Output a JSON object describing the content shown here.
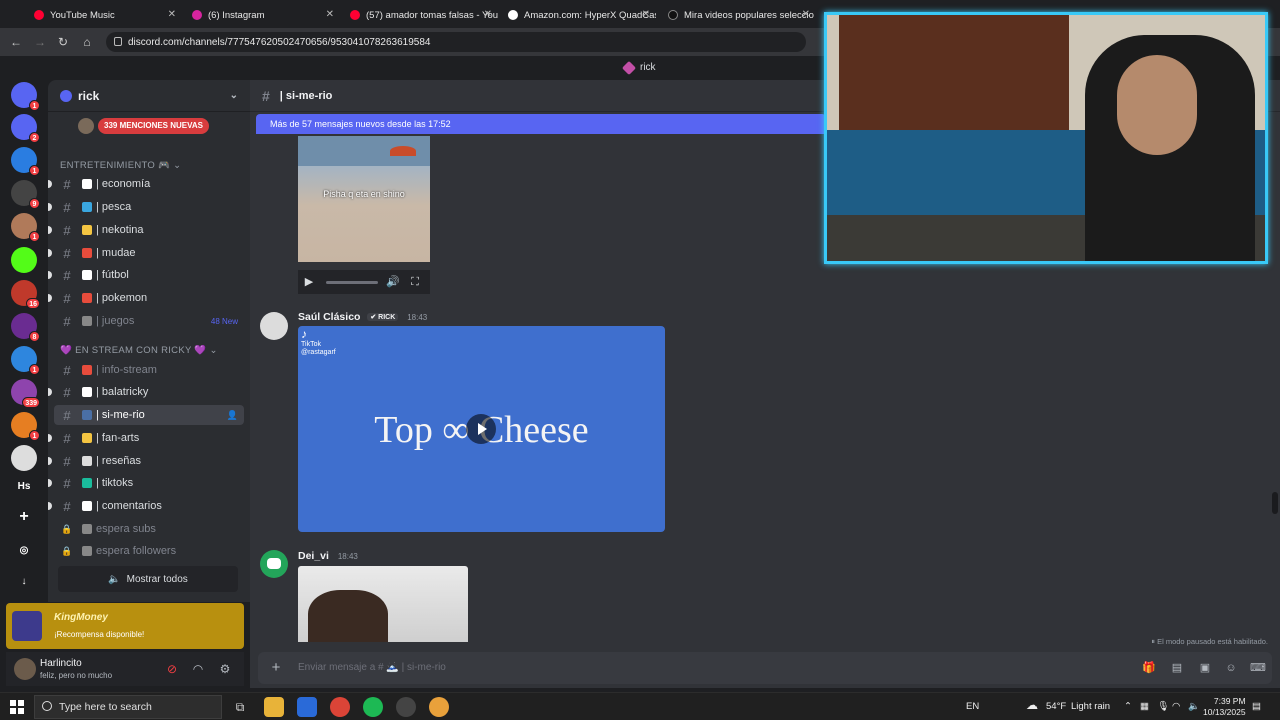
{
  "browser": {
    "tabs": [
      {
        "title": "YouTube Music",
        "color": "#ff0033"
      },
      {
        "title": "(6) Instagram",
        "color": "#d6249f"
      },
      {
        "title": "(57) amador tomas falsas - You",
        "color": "#ff0033"
      },
      {
        "title": "Amazon.com: HyperX QuadCas",
        "color": "#ffffff"
      },
      {
        "title": "Mira videos populares seleccio",
        "color": "#111111"
      }
    ],
    "url": "discord.com/channels/777547620502470656/953041078263619584"
  },
  "title_bar": {
    "server": "rick"
  },
  "guild_rail": {
    "items": [
      {
        "icon": "discord-home-icon",
        "badge": "1",
        "color": "#5865f2"
      },
      {
        "icon": "discord-server-icon",
        "badge": "2",
        "color": "#5865f2"
      },
      {
        "icon": "cube-server-icon",
        "badge": "1",
        "color": "#2a7de1"
      },
      {
        "icon": "mvp-server-icon",
        "badge": "9",
        "color": "#444444"
      },
      {
        "icon": "avatar-server-icon",
        "badge": "1",
        "color": "#b07a5a"
      },
      {
        "icon": "kick-server-icon",
        "badge": "",
        "color": "#53fc18"
      },
      {
        "icon": "red-server-icon",
        "badge": "16",
        "color": "#c0392b"
      },
      {
        "icon": "purple-server-icon",
        "badge": "8",
        "color": "#6a2c91"
      },
      {
        "icon": "globe-server-icon",
        "badge": "1",
        "color": "#2e86de"
      },
      {
        "icon": "grid-server-icon",
        "badge": "339",
        "color": "#8e44ad"
      },
      {
        "icon": "e-server-icon",
        "badge": "1",
        "color": "#e67e22"
      },
      {
        "icon": "troll-server-icon",
        "badge": "",
        "color": "#dddddd"
      },
      {
        "icon": "hs-server-icon",
        "badge": "",
        "color": "#313338",
        "label": "Hs"
      },
      {
        "icon": "add-server-icon",
        "badge": "",
        "color": "#313338"
      },
      {
        "icon": "explore-icon",
        "badge": "",
        "color": "#313338"
      },
      {
        "icon": "download-icon",
        "badge": "",
        "color": "#313338"
      }
    ]
  },
  "sidebar": {
    "server_name": "rick",
    "mentions_badge": "339 MENCIONES NUEVAS",
    "category1": "ENTRETENIMIENTO 🎮",
    "category2": "💜 EN STREAM CON RICKY 💜",
    "channels": [
      {
        "name": "| economía",
        "state": "normal",
        "color": "#ffffff"
      },
      {
        "name": "| pesca",
        "state": "normal",
        "color": "#3aa7e0"
      },
      {
        "name": "| nekotina",
        "state": "normal",
        "color": "#f4c542"
      },
      {
        "name": "| mudae",
        "state": "normal",
        "color": "#e74c3c"
      },
      {
        "name": "| fútbol",
        "state": "normal",
        "color": "#ffffff"
      },
      {
        "name": "| pokemon",
        "state": "normal",
        "color": "#e74c3c"
      },
      {
        "name": "| juegos",
        "state": "muted",
        "color": "#888888",
        "tag": "48 New"
      },
      {
        "name": "| info-stream",
        "state": "muted",
        "color": "#e74c3c"
      },
      {
        "name": "| balatricky",
        "state": "normal",
        "color": "#ffffff"
      },
      {
        "name": "| si-me-rio",
        "state": "active",
        "color": "#4a6fa5"
      },
      {
        "name": "| fan-arts",
        "state": "normal",
        "color": "#f4c542"
      },
      {
        "name": "| reseñas",
        "state": "normal",
        "color": "#dddddd"
      },
      {
        "name": "| tiktoks",
        "state": "normal",
        "color": "#1abc9c"
      },
      {
        "name": "| comentarios",
        "state": "normal",
        "color": "#ffffff"
      },
      {
        "name": "espera subs",
        "state": "locked",
        "color": "#888888"
      },
      {
        "name": "espera followers",
        "state": "locked",
        "color": "#888888"
      }
    ],
    "show_all": "Mostrar todos"
  },
  "reward": {
    "title": "KingMoney",
    "subtitle": "¡Recompensa disponible!"
  },
  "user": {
    "name": "Harlincito",
    "status": "feliz, pero no mucho"
  },
  "chat": {
    "channel": "| si-me-rio",
    "new_messages": "Más de 57 mensajes nuevos desde las 17:52",
    "video_caption": "Pisha q eta en shino",
    "messages": [
      {
        "author": "Saúl Clásico",
        "tag": "✔ RICK",
        "time": "18:43"
      },
      {
        "author": "Dei_vi",
        "tag": "",
        "time": "18:43"
      }
    ],
    "tiktok_brand": "TikTok",
    "tiktok_handle": "@rastagarf",
    "tiktok_text": "Top ∞ Cheese",
    "paused_note": "El modo pausado está habilitado.",
    "composer_placeholder": "Enviar mensaje a # 🗻 | si-me-rio"
  },
  "taskbar": {
    "search_placeholder": "Type here to search",
    "lang": "EN",
    "weather_temp": "54°F",
    "weather_desc": "Light rain",
    "time": "7:39 PM",
    "date": "10/13/2025"
  }
}
